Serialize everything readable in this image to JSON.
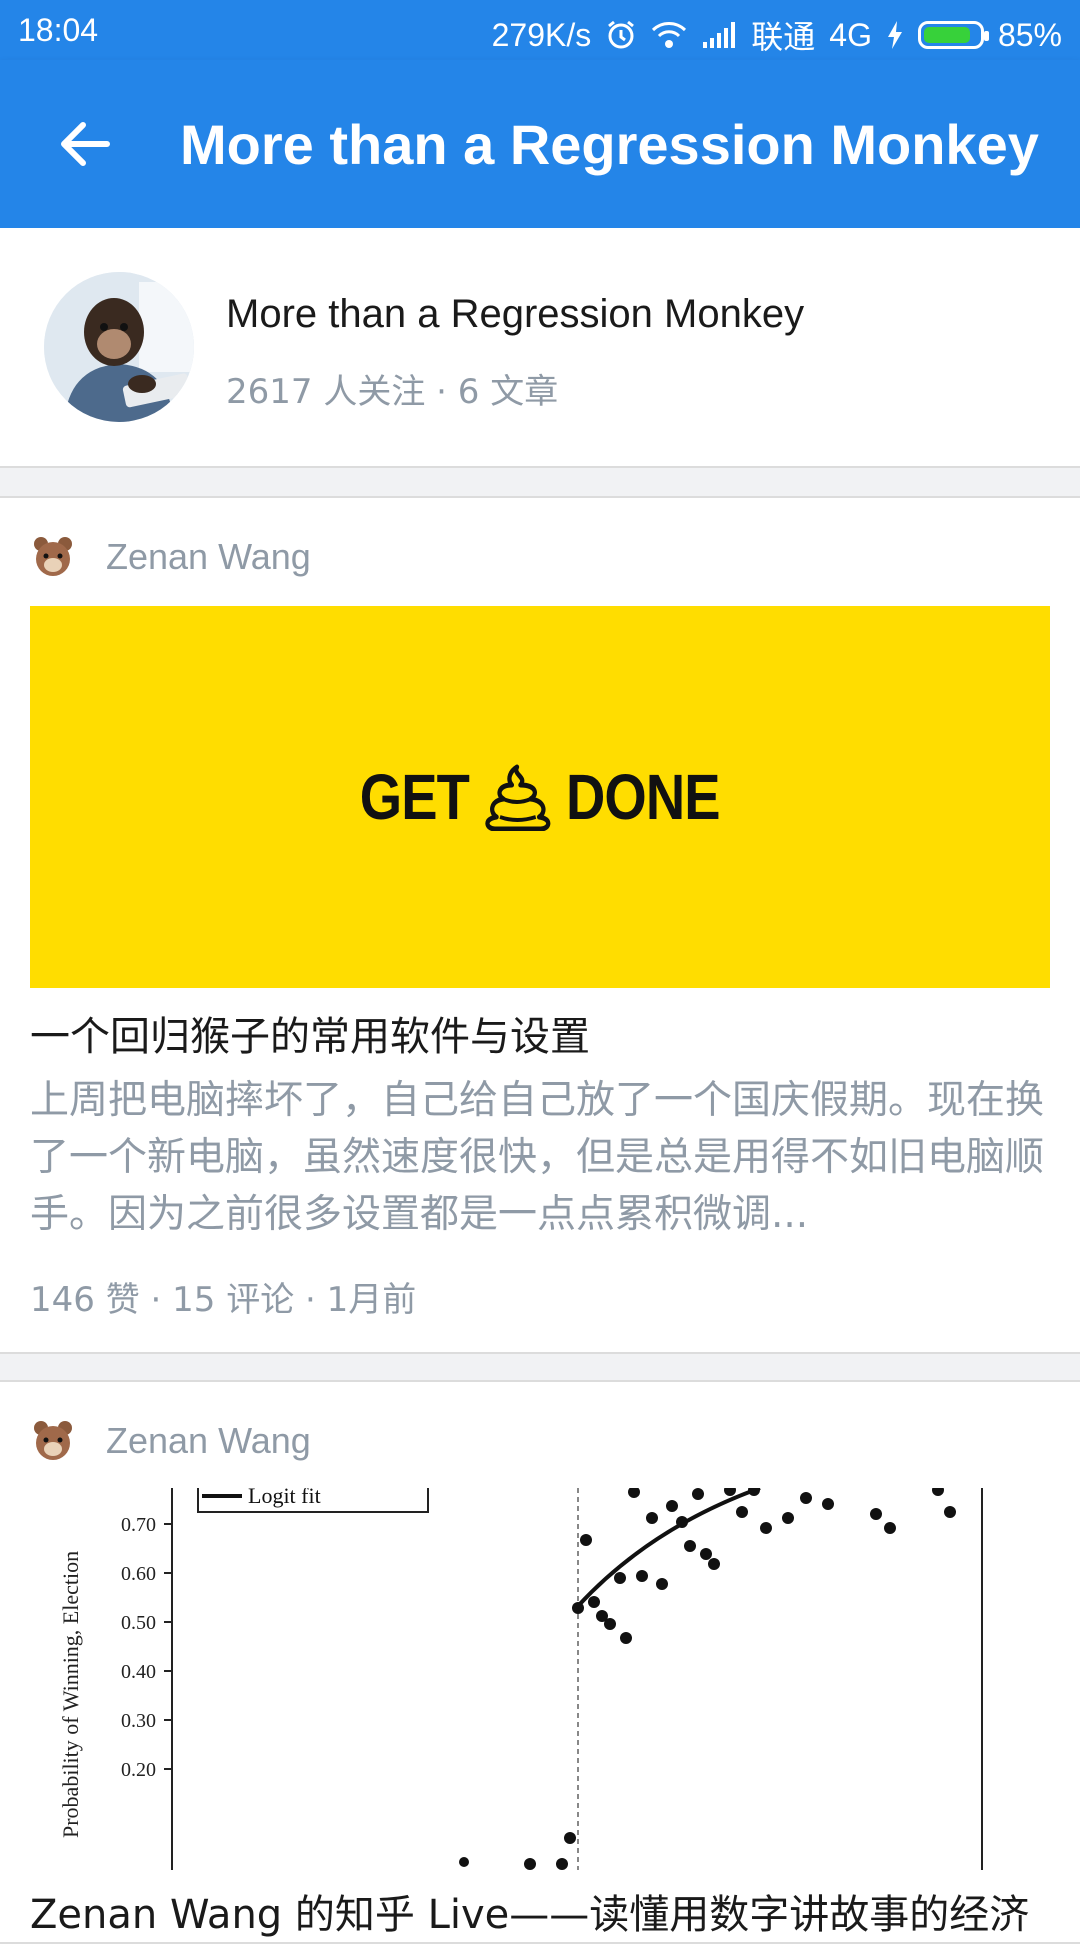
{
  "status_bar": {
    "time": "18:04",
    "speed": "279K/s",
    "carrier": "联通",
    "network": "4G",
    "battery_percent": "85%",
    "battery_level": 0.85,
    "icons": [
      "alarm-icon",
      "wifi-icon",
      "signal-icon",
      "charging-icon",
      "battery-icon"
    ]
  },
  "app_bar": {
    "title": "More than a Regression Monkey",
    "back_icon": "arrow-left-icon"
  },
  "column": {
    "name": "More than a Regression Monkey",
    "meta": "2617 人关注 · 6 文章"
  },
  "posts": [
    {
      "author": "Zenan Wang",
      "cover_text_left": "GET",
      "cover_text_right": "DONE",
      "title": "一个回归猴子的常用软件与设置",
      "excerpt": "上周把电脑摔坏了，自己给自己放了一个国庆假期。现在换了一个新电脑，虽然速度很快，但是总是用得不如旧电脑顺手。因为之前很多设置都是一点点累积微调...",
      "meta": "146 赞 · 15 评论 · 1月前"
    },
    {
      "author": "Zenan Wang",
      "title": "Zenan Wang 的知乎 Live——读懂用数字讲故事的经济",
      "cover_chart": {
        "legend": "Logit fit",
        "ylabel": "Probability of Winning, Election",
        "yticks": [
          "0.70",
          "0.60",
          "0.50",
          "0.40",
          "0.30",
          "0.20"
        ]
      }
    }
  ],
  "colors": {
    "primary": "#2485e8",
    "cover_yellow": "#ffdd00",
    "meta_gray": "#8f9aa6"
  }
}
